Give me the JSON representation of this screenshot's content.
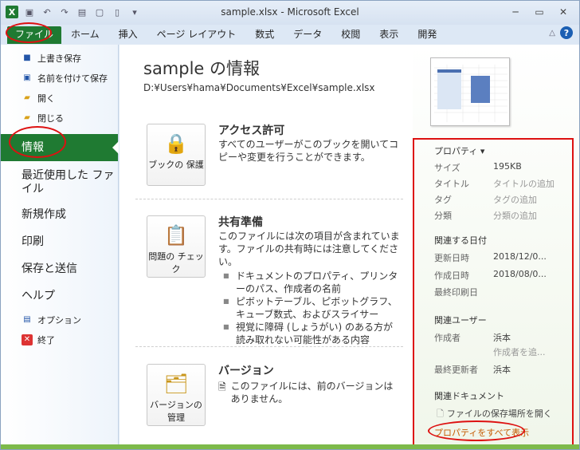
{
  "window": {
    "title": "sample.xlsx - Microsoft Excel",
    "app_logo": "X",
    "accent_color": "#1f7a32"
  },
  "tabs": [
    "ファイル",
    "ホーム",
    "挿入",
    "ページ レイアウト",
    "数式",
    "データ",
    "校閲",
    "表示",
    "開発"
  ],
  "left_menu": {
    "save": "上書き保存",
    "save_as": "名前を付けて保存",
    "open": "開く",
    "close": "閉じる",
    "info": "情報",
    "recent": "最近使用した ファイル",
    "new": "新規作成",
    "print": "印刷",
    "save_send": "保存と送信",
    "help": "ヘルプ",
    "options": "オプション",
    "exit": "終了"
  },
  "info": {
    "title": "sample の情報",
    "path": "D:¥Users¥hama¥Documents¥Excel¥sample.xlsx",
    "permissions": {
      "button": "ブックの 保護",
      "heading": "アクセス許可",
      "desc": "すべてのユーザーがこのブックを開いてコピーや変更を行うことができます。"
    },
    "prepare": {
      "button": "問題の チェック",
      "heading": "共有準備",
      "desc": "このファイルには次の項目が含まれています。ファイルの共有時には注意してください。",
      "items": [
        "ドキュメントのプロパティ、プリンターのパス、作成者の名前",
        "ピボットテーブル、ピボットグラフ、キューブ数式、およびスライサー",
        "視覚に障碍 (しょうがい) のある方が読み取れない可能性がある内容"
      ]
    },
    "versions": {
      "button": "バージョンの 管理",
      "heading": "バージョン",
      "desc": "このファイルには、前のバージョンはありません。"
    }
  },
  "properties": {
    "heading": "プロパティ ▾",
    "size_label": "サイズ",
    "size_value": "195KB",
    "title_label": "タイトル",
    "title_value": "タイトルの追加",
    "tags_label": "タグ",
    "tags_value": "タグの追加",
    "category_label": "分類",
    "category_value": "分類の追加",
    "dates_heading": "関連する日付",
    "modified_label": "更新日時",
    "modified_value": "2018/12/0...",
    "created_label": "作成日時",
    "created_value": "2018/08/0...",
    "printed_label": "最終印刷日",
    "people_heading": "関連ユーザー",
    "author_label": "作成者",
    "author_value": "浜本",
    "add_author": "作成者を追...",
    "last_modified_by_label": "最終更新者",
    "last_modified_by_value": "浜本",
    "docs_heading": "関連ドキュメント",
    "open_location": "ファイルの保存場所を開く",
    "show_all": "プロパティをすべて表示"
  }
}
